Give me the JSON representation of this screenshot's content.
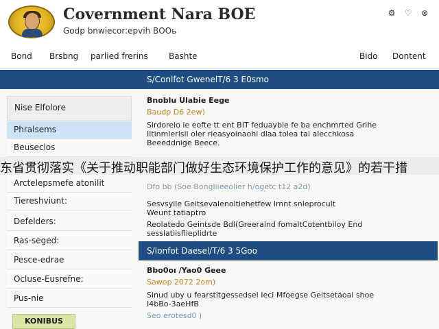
{
  "header": {
    "title": "Covernment Nara BOE",
    "subtitle": "Gоdp bnwiecor:epvih ВООь"
  },
  "nav": {
    "items": [
      "Bond",
      "Brsbng",
      "parlied frerins",
      "Bashte",
      "Bido",
      "Dontent"
    ]
  },
  "overlay": {
    "text": "东省贯彻落实《关于推动职能部门做好生态环境保护工作的意见》的若干措"
  },
  "sidebar": {
    "heading": "Nise Elfolore",
    "items": [
      "Phralsems",
      "Beuseclos",
      "Arctelepsmefe atonilit",
      "Tiereshviunt:",
      "Defelders:",
      "Ras-seged:",
      "Pesce-edrae",
      "Ocluse-Eusrefne:",
      "Pus-nie"
    ],
    "button": "KONIBUS"
  },
  "main": {
    "section1": "S/Conlfot GwenelT/6 3 E0smo",
    "section2": "S/Ionfot Daesel/T/6 3 5Goo",
    "article1": {
      "title": "Bnoblu Ulabie Eege",
      "date": "Baudp D6 2ew)",
      "lines": [
        "Sirdorelo ie eofte tt ent BIT feduaybie fe ba enchmrted Grihe",
        "Iltinmlerlsil oler rieasyoinaohi dlaa tolea tal alecchkosa",
        "Beeeddnige Beece."
      ]
    },
    "article2": {
      "date": "Dfo bb (Soe Bongliieeolier h/ogetc t12 a2d)",
      "lines": [
        "Sesvsyile Geitsevalenoltiehetfew lrnnt snleprocult",
        "Weunt tatiaptro",
        "Reolatedo Geintsde Bdl(Greeralnd fomaltCotentbiloy End",
        "sesslatiisflieplidrte"
      ]
    },
    "article3": {
      "title": "Bbo0oı /Yao0 Geee",
      "date": "Sawop 2072 2om)",
      "lines": [
        "Sinud uby u fearstitgessedsel Iecl Mfoegse Geitsetaoal shoe",
        "I4bBo-3aeHfB",
        "Seo erotesd0 )"
      ]
    }
  },
  "colors": {
    "primary": "#1f4d82",
    "accent_date": "#c8821a",
    "sidebar_active": "#cfe3f6",
    "button": "#d9e6a7"
  }
}
